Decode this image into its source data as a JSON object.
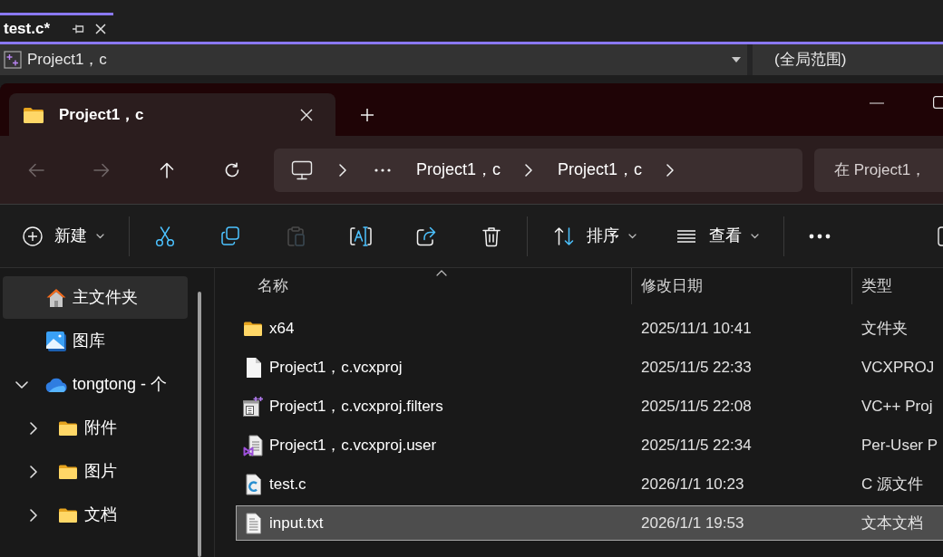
{
  "editor": {
    "tab": {
      "title": "test.c*"
    },
    "navigation": {
      "project": "Project1，c",
      "scope": "(全局范围)"
    }
  },
  "explorer": {
    "tabs": [
      {
        "title": "Project1，c",
        "selected": true
      }
    ],
    "nav_buttons": [
      {
        "kind": "back",
        "disabled": true
      },
      {
        "kind": "forward",
        "disabled": true
      },
      {
        "kind": "up",
        "disabled": false
      },
      {
        "kind": "refresh",
        "disabled": false
      }
    ],
    "address_bar": {
      "crumbs": [
        "Project1，c",
        "Project1，c"
      ]
    },
    "search": {
      "placeholder": "在 Project1，"
    },
    "toolbar": {
      "groups": [
        [
          {
            "kind": "new",
            "label": "新建",
            "disabled": false
          }
        ],
        [
          {
            "kind": "cut",
            "disabled": false
          },
          {
            "kind": "copy",
            "disabled": false
          },
          {
            "kind": "paste",
            "disabled": true
          },
          {
            "kind": "rename",
            "disabled": false
          },
          {
            "kind": "share",
            "disabled": false
          },
          {
            "kind": "delete",
            "disabled": false
          }
        ],
        [
          {
            "kind": "sort",
            "label": "排序",
            "disabled": false
          },
          {
            "kind": "view",
            "label": "查看",
            "disabled": false
          }
        ],
        [
          {
            "kind": "more",
            "disabled": false
          }
        ]
      ]
    },
    "sidebar": {
      "items": [
        {
          "kind": "home",
          "label": "主文件夹",
          "selected": true
        },
        {
          "kind": "gallery",
          "label": "图库",
          "selected": false
        },
        {
          "kind": "cloud",
          "label": "tongtong - 个",
          "selected": false,
          "expanded": true,
          "children": [
            {
              "kind": "folder",
              "label": "附件",
              "selected": false,
              "expanded": false
            },
            {
              "kind": "folder",
              "label": "图片",
              "selected": false,
              "expanded": false
            },
            {
              "kind": "folder",
              "label": "文档",
              "selected": false,
              "expanded": false
            }
          ]
        }
      ]
    },
    "file_list": {
      "columns": [
        {
          "label": "名称",
          "sorted": true
        },
        {
          "label": "修改日期",
          "sorted": false
        },
        {
          "label": "类型",
          "sorted": false
        }
      ],
      "rows": [
        {
          "kind": "folder",
          "name": "x64",
          "modified": "2025/11/1 10:41",
          "type": "文件夹",
          "selected": false
        },
        {
          "kind": "file",
          "name": "Project1，c.vcxproj",
          "modified": "2025/11/5 22:33",
          "type": "VCXPROJ",
          "selected": false
        },
        {
          "kind": "filters",
          "name": "Project1，c.vcxproj.filters",
          "modified": "2025/11/5 22:08",
          "type": "VC++ Proj",
          "selected": false
        },
        {
          "kind": "user",
          "name": "Project1，c.vcxproj.user",
          "modified": "2025/11/5 22:34",
          "type": "Per-User P",
          "selected": false
        },
        {
          "kind": "c",
          "name": "test.c",
          "modified": "2026/1/1 10:23",
          "type": "C 源文件",
          "selected": false
        },
        {
          "kind": "text",
          "name": "input.txt",
          "modified": "2026/1/1 19:53",
          "type": "文本文档",
          "selected": true
        }
      ]
    }
  }
}
